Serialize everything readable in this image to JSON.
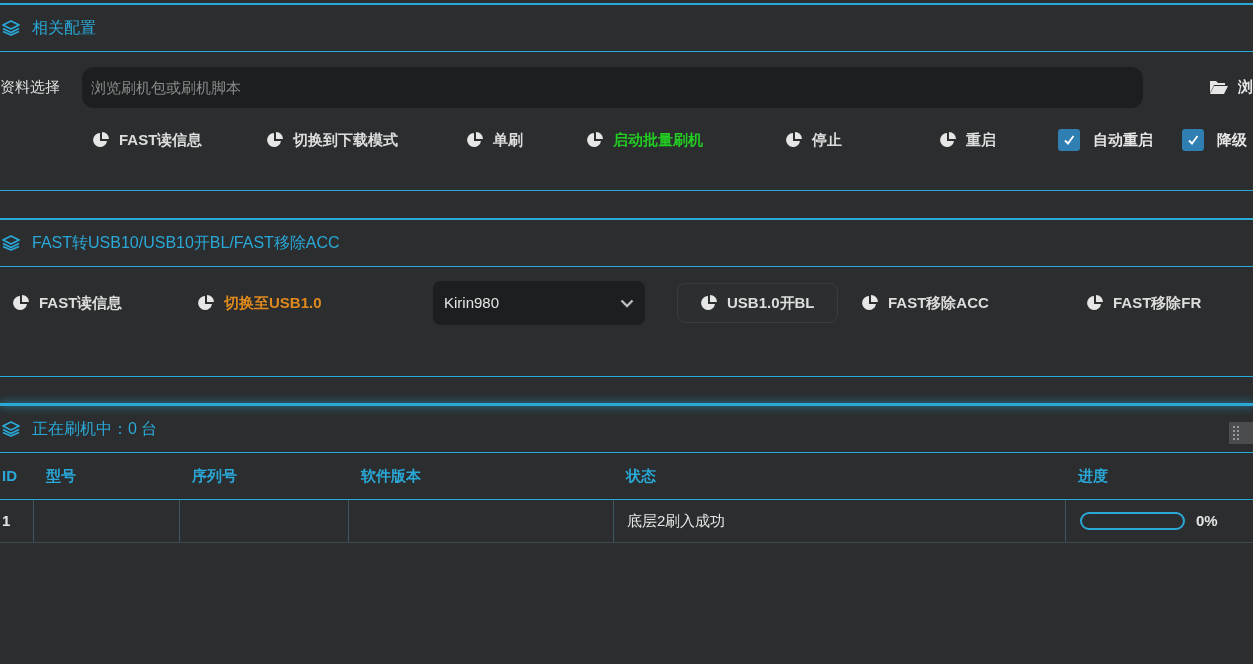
{
  "config": {
    "title": "相关配置",
    "file_label": "资料选择",
    "file_placeholder": "浏览刷机包或刷机脚本",
    "browse_label": "浏",
    "actions": [
      {
        "kind": "action",
        "label": "FAST读信息",
        "color": "#dddddd"
      },
      {
        "kind": "action",
        "label": "切换到下载模式",
        "color": "#dddddd"
      },
      {
        "kind": "action",
        "label": "单刷",
        "color": "#dddddd"
      },
      {
        "kind": "action",
        "label": "启动批量刷机",
        "color": "#22cc22"
      },
      {
        "kind": "action",
        "label": "停止",
        "color": "#dddddd"
      },
      {
        "kind": "action",
        "label": "重启",
        "color": "#dddddd"
      },
      {
        "kind": "checkbox",
        "label": "自动重启",
        "checked": true
      },
      {
        "kind": "checkbox",
        "label": "降级",
        "checked": true
      }
    ]
  },
  "usb": {
    "title": "FAST转USB10/USB10开BL/FAST移除ACC",
    "actions": [
      {
        "kind": "action",
        "label": "FAST读信息",
        "color": "#dddddd"
      },
      {
        "kind": "action",
        "label": "切换至USB1.0",
        "color": "#e08a1e"
      },
      {
        "kind": "select",
        "value": "Kirin980"
      },
      {
        "kind": "action",
        "label": "USB1.0开BL",
        "color": "#dddddd"
      },
      {
        "kind": "action",
        "label": "FAST移除ACC",
        "color": "#dddddd"
      },
      {
        "kind": "action",
        "label": "FAST移除FR",
        "color": "#dddddd"
      }
    ]
  },
  "flashing": {
    "title": "正在刷机中：0 台",
    "table": {
      "columns": [
        "ID",
        "型号",
        "序列号",
        "软件版本",
        "状态",
        "进度"
      ],
      "rows": [
        {
          "id": "1",
          "model": "",
          "serial": "",
          "version": "",
          "status": "底层2刷入成功",
          "level": 0,
          "progress": "0%"
        }
      ]
    }
  }
}
